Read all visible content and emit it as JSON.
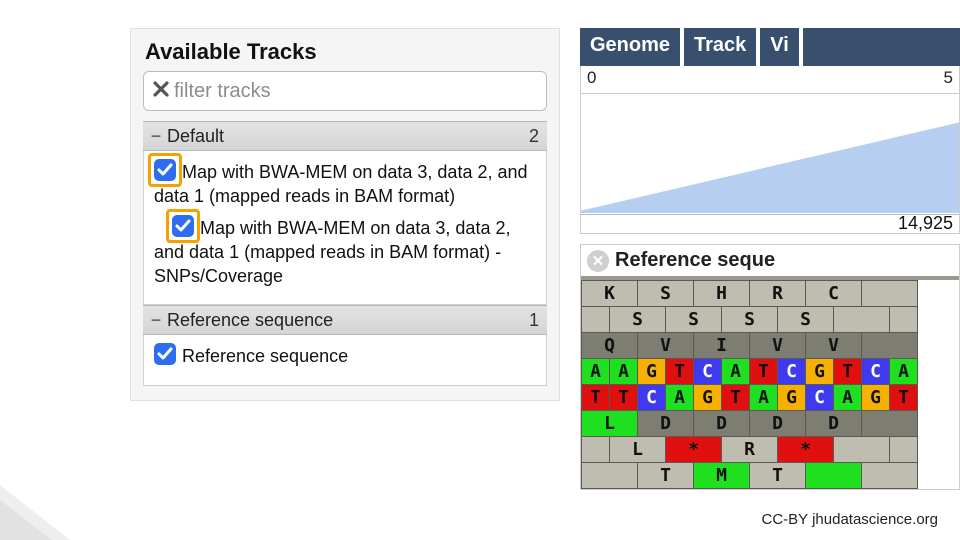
{
  "panel": {
    "title": "Available Tracks",
    "filter_placeholder": "filter tracks",
    "groups": [
      {
        "name": "Default",
        "count": "2",
        "tracks": [
          {
            "label": "Map with BWA-MEM on data 3, data 2, and data 1 (mapped reads in BAM format)",
            "checked": true,
            "highlighted": true
          },
          {
            "label": "Map with BWA-MEM on data 3, data 2, and data 1 (mapped reads in BAM format) - SNPs/Coverage",
            "checked": true,
            "highlighted": true
          }
        ]
      },
      {
        "name": "Reference sequence",
        "count": "1",
        "tracks": [
          {
            "label": "Reference sequence",
            "checked": true,
            "highlighted": false
          }
        ]
      }
    ]
  },
  "browser": {
    "menu": [
      "Genome",
      "Track",
      "Vi"
    ],
    "ruler": {
      "start": "0",
      "end": "5"
    },
    "coverage_value": "14,925",
    "seq_title": "Reference seque",
    "rows": [
      {
        "cells": [
          {
            "t": "K",
            "bg": "#bfbdb0",
            "w": 2
          },
          {
            "t": "S",
            "bg": "#bfbdb0",
            "w": 2
          },
          {
            "t": "H",
            "bg": "#bfbdb0",
            "w": 2
          },
          {
            "t": "R",
            "bg": "#bfbdb0",
            "w": 2
          },
          {
            "t": "C",
            "bg": "#bfbdb0",
            "w": 2
          },
          {
            "t": "",
            "bg": "#bfbdb0",
            "w": 2
          }
        ]
      },
      {
        "cells": [
          {
            "t": "",
            "bg": "#bfbdb0",
            "w": 1
          },
          {
            "t": "S",
            "bg": "#bfbdb0",
            "w": 2
          },
          {
            "t": "S",
            "bg": "#bfbdb0",
            "w": 2
          },
          {
            "t": "S",
            "bg": "#bfbdb0",
            "w": 2
          },
          {
            "t": "S",
            "bg": "#bfbdb0",
            "w": 2
          },
          {
            "t": "",
            "bg": "#bfbdb0",
            "w": 2
          },
          {
            "t": "",
            "bg": "#bfbdb0",
            "w": 1
          }
        ]
      },
      {
        "cells": [
          {
            "t": "Q",
            "bg": "#7d7d72",
            "w": 2
          },
          {
            "t": "V",
            "bg": "#7d7d72",
            "w": 2
          },
          {
            "t": "I",
            "bg": "#7d7d72",
            "w": 2
          },
          {
            "t": "V",
            "bg": "#7d7d72",
            "w": 2
          },
          {
            "t": "V",
            "bg": "#7d7d72",
            "w": 2
          },
          {
            "t": "",
            "bg": "#7d7d72",
            "w": 2
          }
        ]
      },
      {
        "cells": [
          {
            "t": "A",
            "bg": "#1ee01e"
          },
          {
            "t": "A",
            "bg": "#1ee01e"
          },
          {
            "t": "G",
            "bg": "#f6b000"
          },
          {
            "t": "T",
            "bg": "#e01010"
          },
          {
            "t": "C",
            "bg": "#3e3af0",
            "fg": "#fff"
          },
          {
            "t": "A",
            "bg": "#1ee01e"
          },
          {
            "t": "T",
            "bg": "#e01010"
          },
          {
            "t": "C",
            "bg": "#3e3af0",
            "fg": "#fff"
          },
          {
            "t": "G",
            "bg": "#f6b000"
          },
          {
            "t": "T",
            "bg": "#e01010"
          },
          {
            "t": "C",
            "bg": "#3e3af0",
            "fg": "#fff"
          },
          {
            "t": "A",
            "bg": "#1ee01e"
          }
        ]
      },
      {
        "cells": [
          {
            "t": "T",
            "bg": "#e01010"
          },
          {
            "t": "T",
            "bg": "#e01010"
          },
          {
            "t": "C",
            "bg": "#3e3af0",
            "fg": "#fff"
          },
          {
            "t": "A",
            "bg": "#1ee01e"
          },
          {
            "t": "G",
            "bg": "#f6b000"
          },
          {
            "t": "T",
            "bg": "#e01010"
          },
          {
            "t": "A",
            "bg": "#1ee01e"
          },
          {
            "t": "G",
            "bg": "#f6b000"
          },
          {
            "t": "C",
            "bg": "#3e3af0",
            "fg": "#fff"
          },
          {
            "t": "A",
            "bg": "#1ee01e"
          },
          {
            "t": "G",
            "bg": "#f6b000"
          },
          {
            "t": "T",
            "bg": "#e01010"
          }
        ]
      },
      {
        "cells": [
          {
            "t": "L",
            "bg": "#1ee01e",
            "w": 2
          },
          {
            "t": "D",
            "bg": "#7d7d72",
            "w": 2
          },
          {
            "t": "D",
            "bg": "#7d7d72",
            "w": 2
          },
          {
            "t": "D",
            "bg": "#7d7d72",
            "w": 2
          },
          {
            "t": "D",
            "bg": "#7d7d72",
            "w": 2
          },
          {
            "t": "",
            "bg": "#7d7d72",
            "w": 2
          }
        ]
      },
      {
        "cells": [
          {
            "t": "",
            "bg": "#bfbdb0",
            "w": 1
          },
          {
            "t": "L",
            "bg": "#bfbdb0",
            "w": 2
          },
          {
            "t": "*",
            "bg": "#e01010",
            "w": 2
          },
          {
            "t": "R",
            "bg": "#bfbdb0",
            "w": 2
          },
          {
            "t": "*",
            "bg": "#e01010",
            "w": 2
          },
          {
            "t": "",
            "bg": "#bfbdb0",
            "w": 2
          },
          {
            "t": "",
            "bg": "#bfbdb0",
            "w": 1
          }
        ]
      },
      {
        "cells": [
          {
            "t": "",
            "bg": "#bfbdb0",
            "w": 2
          },
          {
            "t": "T",
            "bg": "#bfbdb0",
            "w": 2
          },
          {
            "t": "M",
            "bg": "#1ee01e",
            "w": 2
          },
          {
            "t": "T",
            "bg": "#bfbdb0",
            "w": 2
          },
          {
            "t": "",
            "bg": "#1ee01e",
            "w": 2
          },
          {
            "t": "",
            "bg": "#bfbdb0",
            "w": 2
          }
        ]
      }
    ]
  },
  "footer": "CC-BY  jhudatascience.org"
}
